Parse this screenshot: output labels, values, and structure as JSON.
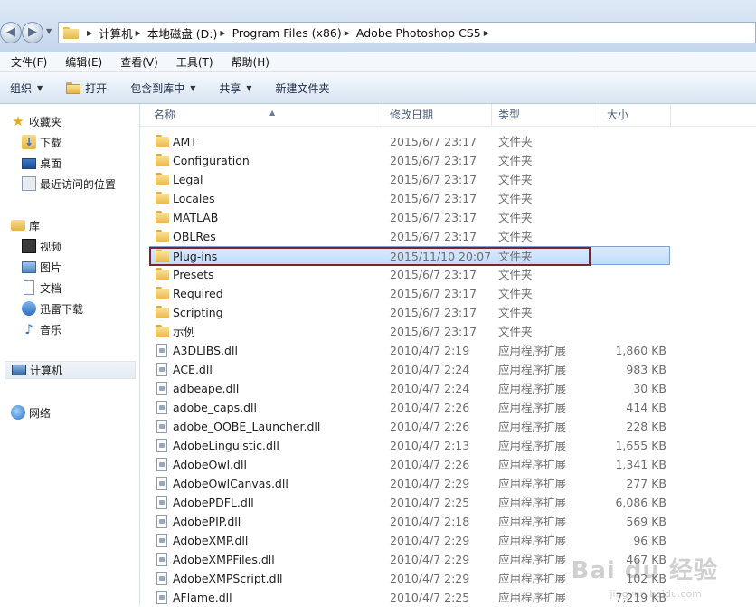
{
  "address_bar": {
    "crumbs": [
      "计算机",
      "本地磁盘 (D:)",
      "Program Files (x86)",
      "Adobe Photoshop CS5"
    ]
  },
  "menu": [
    "文件(F)",
    "编辑(E)",
    "查看(V)",
    "工具(T)",
    "帮助(H)"
  ],
  "toolbar": {
    "organize": "组织",
    "open": "打开",
    "include_library": "包含到库中",
    "share": "共享",
    "new_folder": "新建文件夹"
  },
  "nav": {
    "favorites": "收藏夹",
    "favorites_items": [
      "下载",
      "桌面",
      "最近访问的位置"
    ],
    "libraries": "库",
    "library_items": [
      "视频",
      "图片",
      "文档",
      "迅雷下载",
      "音乐"
    ],
    "computer": "计算机",
    "network": "网络"
  },
  "columns": {
    "name": "名称",
    "date": "修改日期",
    "type": "类型",
    "size": "大小"
  },
  "files": [
    {
      "name": "AMT",
      "date": "2015/6/7 23:17",
      "type": "文件夹",
      "size": "",
      "kind": "folder"
    },
    {
      "name": "Configuration",
      "date": "2015/6/7 23:17",
      "type": "文件夹",
      "size": "",
      "kind": "folder"
    },
    {
      "name": "Legal",
      "date": "2015/6/7 23:17",
      "type": "文件夹",
      "size": "",
      "kind": "folder"
    },
    {
      "name": "Locales",
      "date": "2015/6/7 23:17",
      "type": "文件夹",
      "size": "",
      "kind": "folder"
    },
    {
      "name": "MATLAB",
      "date": "2015/6/7 23:17",
      "type": "文件夹",
      "size": "",
      "kind": "folder"
    },
    {
      "name": "OBLRes",
      "date": "2015/6/7 23:17",
      "type": "文件夹",
      "size": "",
      "kind": "folder"
    },
    {
      "name": "Plug-ins",
      "date": "2015/11/10 20:07",
      "type": "文件夹",
      "size": "",
      "kind": "folder",
      "selected": true
    },
    {
      "name": "Presets",
      "date": "2015/6/7 23:17",
      "type": "文件夹",
      "size": "",
      "kind": "folder"
    },
    {
      "name": "Required",
      "date": "2015/6/7 23:17",
      "type": "文件夹",
      "size": "",
      "kind": "folder"
    },
    {
      "name": "Scripting",
      "date": "2015/6/7 23:17",
      "type": "文件夹",
      "size": "",
      "kind": "folder"
    },
    {
      "name": "示例",
      "date": "2015/6/7 23:17",
      "type": "文件夹",
      "size": "",
      "kind": "folder"
    },
    {
      "name": "A3DLIBS.dll",
      "date": "2010/4/7 2:19",
      "type": "应用程序扩展",
      "size": "1,860 KB",
      "kind": "dll"
    },
    {
      "name": "ACE.dll",
      "date": "2010/4/7 2:24",
      "type": "应用程序扩展",
      "size": "983 KB",
      "kind": "dll"
    },
    {
      "name": "adbeape.dll",
      "date": "2010/4/7 2:24",
      "type": "应用程序扩展",
      "size": "30 KB",
      "kind": "dll"
    },
    {
      "name": "adobe_caps.dll",
      "date": "2010/4/7 2:26",
      "type": "应用程序扩展",
      "size": "414 KB",
      "kind": "dll"
    },
    {
      "name": "adobe_OOBE_Launcher.dll",
      "date": "2010/4/7 2:26",
      "type": "应用程序扩展",
      "size": "228 KB",
      "kind": "dll"
    },
    {
      "name": "AdobeLinguistic.dll",
      "date": "2010/4/7 2:13",
      "type": "应用程序扩展",
      "size": "1,655 KB",
      "kind": "dll"
    },
    {
      "name": "AdobeOwl.dll",
      "date": "2010/4/7 2:26",
      "type": "应用程序扩展",
      "size": "1,341 KB",
      "kind": "dll"
    },
    {
      "name": "AdobeOwlCanvas.dll",
      "date": "2010/4/7 2:29",
      "type": "应用程序扩展",
      "size": "277 KB",
      "kind": "dll"
    },
    {
      "name": "AdobePDFL.dll",
      "date": "2010/4/7 2:25",
      "type": "应用程序扩展",
      "size": "6,086 KB",
      "kind": "dll"
    },
    {
      "name": "AdobePIP.dll",
      "date": "2010/4/7 2:18",
      "type": "应用程序扩展",
      "size": "569 KB",
      "kind": "dll"
    },
    {
      "name": "AdobeXMP.dll",
      "date": "2010/4/7 2:29",
      "type": "应用程序扩展",
      "size": "96 KB",
      "kind": "dll"
    },
    {
      "name": "AdobeXMPFiles.dll",
      "date": "2010/4/7 2:29",
      "type": "应用程序扩展",
      "size": "467 KB",
      "kind": "dll"
    },
    {
      "name": "AdobeXMPScript.dll",
      "date": "2010/4/7 2:29",
      "type": "应用程序扩展",
      "size": "102 KB",
      "kind": "dll"
    },
    {
      "name": "AFlame.dll",
      "date": "2010/4/7 2:25",
      "type": "应用程序扩展",
      "size": "7,219 KB",
      "kind": "dll"
    }
  ],
  "watermark": {
    "logo": "Bai du 经验",
    "sub": "jingyan.baidu.com"
  },
  "colors": {
    "selection_outline": "#7b2330",
    "selection_fill": "#c1dbfc",
    "folder": "#e7b646"
  }
}
